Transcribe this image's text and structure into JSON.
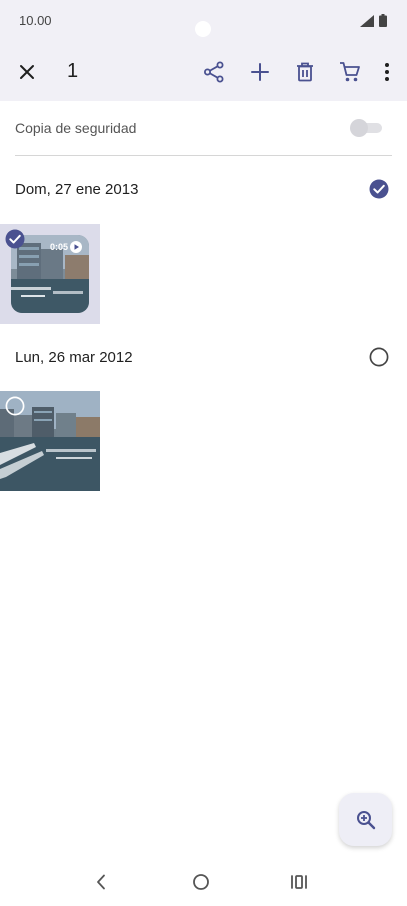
{
  "status_bar": {
    "time": "10.00"
  },
  "toolbar": {
    "selected_count": "1",
    "icons": [
      "close-icon",
      "share-icon",
      "add-icon",
      "delete-icon",
      "shopping-cart-icon",
      "more-vert-icon"
    ]
  },
  "backup": {
    "label": "Copia de seguridad",
    "enabled": false
  },
  "groups": [
    {
      "date": "Dom, 27 ene 2013",
      "selected": true,
      "video_duration": "0:05"
    },
    {
      "date": "Lun, 26 mar 2012",
      "selected": false
    }
  ],
  "colors": {
    "accent": "#4a5190",
    "toolbar_bg": "#f1f0f6",
    "selected_tile_bg": "#dcdcea"
  },
  "fab": {
    "icon": "zoom-in-icon"
  },
  "nav": {
    "icons": [
      "back-icon",
      "home-icon",
      "recents-icon"
    ]
  }
}
